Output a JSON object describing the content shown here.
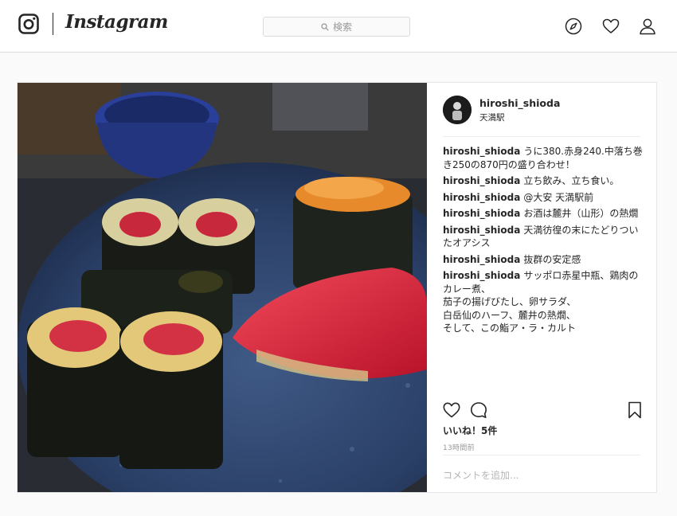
{
  "header": {
    "brand": "Instagram",
    "search_placeholder": "検索"
  },
  "post": {
    "author": "hiroshi_shioda",
    "location": "天満駅",
    "comments": [
      {
        "user": "hiroshi_shioda",
        "text": "うに380.赤身240.中落ち巻き250の870円の盛り合わせ！"
      },
      {
        "user": "hiroshi_shioda",
        "text": "立ち飲み、立ち食い。"
      },
      {
        "user": "hiroshi_shioda",
        "text": "@大安 天満駅前"
      },
      {
        "user": "hiroshi_shioda",
        "text": "お酒は麓井（山形）の熱燗"
      },
      {
        "user": "hiroshi_shioda",
        "text": "天満彷徨の末にたどりついたオアシス"
      },
      {
        "user": "hiroshi_shioda",
        "text": "抜群の安定感"
      },
      {
        "user": "hiroshi_shioda",
        "text": "サッポロ赤星中瓶、鶏肉のカレー煮、\n茄子の揚げびたし、卵サラダ、\n白岳仙のハーフ、麓井の熱燗、\nそして、この鮨ア・ラ・カルト"
      }
    ],
    "likes": "いいね！5件",
    "time": "13時間前",
    "add_comment_placeholder": "コメントを追加..."
  }
}
